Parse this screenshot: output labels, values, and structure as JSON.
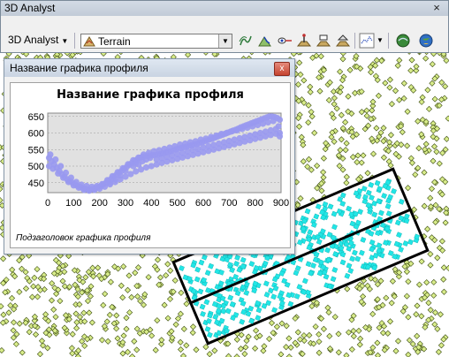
{
  "toolbar": {
    "title": "3D Analyst",
    "close_glyph": "×",
    "menu_label": "3D Analyst",
    "layer_value": "Terrain",
    "tools": [
      "contour-icon",
      "steepest-path-icon",
      "line-of-sight-icon",
      "interpolate-point-icon",
      "interpolate-line-icon",
      "interpolate-polygon-icon",
      "profile-graph-icon",
      "arcscene-icon",
      "arcglobe-icon"
    ]
  },
  "profile_window": {
    "title": "Название графика профиля",
    "close_glyph": "x"
  },
  "chart_data": {
    "type": "scatter",
    "title": "Название графика профиля",
    "subtitle": "Подзаголовок графика профиля",
    "xlabel": "",
    "ylabel": "",
    "xlim": [
      0,
      900
    ],
    "ylim": [
      420,
      660
    ],
    "x_ticks": [
      0,
      100,
      200,
      300,
      400,
      500,
      600,
      700,
      800,
      900
    ],
    "y_ticks": [
      450,
      500,
      550,
      600,
      650
    ],
    "grid": true,
    "series": [
      {
        "color": "#9999f0",
        "points": [
          [
            5,
            525
          ],
          [
            15,
            515
          ],
          [
            25,
            505
          ],
          [
            35,
            495
          ],
          [
            45,
            485
          ],
          [
            55,
            475
          ],
          [
            65,
            468
          ],
          [
            75,
            460
          ],
          [
            85,
            455
          ],
          [
            95,
            450
          ],
          [
            105,
            445
          ],
          [
            115,
            440
          ],
          [
            125,
            437
          ],
          [
            135,
            434
          ],
          [
            145,
            432
          ],
          [
            155,
            430
          ],
          [
            165,
            430
          ],
          [
            175,
            431
          ],
          [
            185,
            433
          ],
          [
            195,
            436
          ],
          [
            205,
            440
          ],
          [
            215,
            445
          ],
          [
            225,
            450
          ],
          [
            235,
            456
          ],
          [
            245,
            462
          ],
          [
            255,
            468
          ],
          [
            265,
            474
          ],
          [
            275,
            480
          ],
          [
            285,
            486
          ],
          [
            295,
            492
          ],
          [
            305,
            498
          ],
          [
            315,
            504
          ],
          [
            325,
            510
          ],
          [
            335,
            516
          ],
          [
            345,
            520
          ],
          [
            355,
            525
          ],
          [
            365,
            528
          ],
          [
            375,
            530
          ],
          [
            385,
            531
          ],
          [
            395,
            532
          ],
          [
            405,
            533
          ],
          [
            415,
            534
          ],
          [
            425,
            535
          ],
          [
            435,
            537
          ],
          [
            445,
            539
          ],
          [
            455,
            541
          ],
          [
            465,
            543
          ],
          [
            475,
            545
          ],
          [
            485,
            548
          ],
          [
            495,
            551
          ],
          [
            505,
            553
          ],
          [
            515,
            555
          ],
          [
            525,
            557
          ],
          [
            535,
            559
          ],
          [
            545,
            561
          ],
          [
            555,
            563
          ],
          [
            565,
            565
          ],
          [
            575,
            567
          ],
          [
            585,
            570
          ],
          [
            595,
            572
          ],
          [
            605,
            575
          ],
          [
            615,
            578
          ],
          [
            625,
            580
          ],
          [
            635,
            583
          ],
          [
            645,
            586
          ],
          [
            655,
            589
          ],
          [
            665,
            592
          ],
          [
            675,
            595
          ],
          [
            685,
            598
          ],
          [
            695,
            601
          ],
          [
            705,
            604
          ],
          [
            715,
            607
          ],
          [
            725,
            610
          ],
          [
            735,
            613
          ],
          [
            745,
            617
          ],
          [
            755,
            620
          ],
          [
            765,
            623
          ],
          [
            775,
            626
          ],
          [
            785,
            629
          ],
          [
            795,
            632
          ],
          [
            805,
            635
          ],
          [
            815,
            638
          ],
          [
            825,
            641
          ],
          [
            835,
            644
          ],
          [
            845,
            647
          ],
          [
            855,
            650
          ],
          [
            865,
            650
          ],
          [
            875,
            648
          ],
          [
            885,
            645
          ],
          [
            895,
            640
          ],
          [
            5,
            500
          ],
          [
            20,
            492
          ],
          [
            40,
            478
          ],
          [
            60,
            465
          ],
          [
            80,
            452
          ],
          [
            100,
            442
          ],
          [
            120,
            435
          ],
          [
            140,
            428
          ],
          [
            160,
            426
          ],
          [
            180,
            428
          ],
          [
            200,
            432
          ],
          [
            220,
            438
          ],
          [
            240,
            445
          ],
          [
            260,
            452
          ],
          [
            280,
            460
          ],
          [
            300,
            468
          ],
          [
            320,
            476
          ],
          [
            340,
            484
          ],
          [
            360,
            490
          ],
          [
            380,
            496
          ],
          [
            400,
            500
          ],
          [
            420,
            505
          ],
          [
            440,
            510
          ],
          [
            460,
            514
          ],
          [
            480,
            518
          ],
          [
            500,
            522
          ],
          [
            520,
            526
          ],
          [
            540,
            530
          ],
          [
            560,
            534
          ],
          [
            580,
            538
          ],
          [
            600,
            542
          ],
          [
            620,
            546
          ],
          [
            640,
            550
          ],
          [
            660,
            554
          ],
          [
            680,
            558
          ],
          [
            700,
            562
          ],
          [
            720,
            566
          ],
          [
            740,
            570
          ],
          [
            760,
            574
          ],
          [
            780,
            578
          ],
          [
            800,
            582
          ],
          [
            820,
            586
          ],
          [
            840,
            590
          ],
          [
            860,
            594
          ],
          [
            880,
            598
          ],
          [
            895,
            600
          ],
          [
            10,
            535
          ],
          [
            30,
            520
          ],
          [
            50,
            500
          ],
          [
            70,
            480
          ],
          [
            90,
            465
          ],
          [
            110,
            452
          ],
          [
            130,
            444
          ],
          [
            150,
            440
          ],
          [
            170,
            438
          ],
          [
            190,
            440
          ],
          [
            210,
            446
          ],
          [
            230,
            458
          ],
          [
            250,
            470
          ],
          [
            270,
            482
          ],
          [
            290,
            494
          ],
          [
            310,
            506
          ],
          [
            330,
            518
          ],
          [
            350,
            526
          ],
          [
            370,
            535
          ],
          [
            390,
            540
          ],
          [
            410,
            545
          ],
          [
            430,
            548
          ],
          [
            450,
            552
          ],
          [
            470,
            556
          ],
          [
            490,
            560
          ],
          [
            510,
            565
          ],
          [
            530,
            568
          ],
          [
            550,
            572
          ],
          [
            570,
            575
          ],
          [
            590,
            580
          ],
          [
            610,
            583
          ],
          [
            630,
            588
          ],
          [
            650,
            592
          ],
          [
            670,
            597
          ],
          [
            690,
            600
          ],
          [
            710,
            605
          ],
          [
            730,
            608
          ],
          [
            750,
            612
          ],
          [
            770,
            616
          ],
          [
            790,
            620
          ],
          [
            810,
            624
          ],
          [
            830,
            628
          ],
          [
            850,
            632
          ],
          [
            870,
            636
          ],
          [
            890,
            620
          ],
          [
            420,
            520
          ],
          [
            440,
            524
          ],
          [
            460,
            528
          ],
          [
            480,
            532
          ],
          [
            500,
            536
          ],
          [
            520,
            540
          ],
          [
            540,
            544
          ],
          [
            560,
            548
          ],
          [
            580,
            552
          ],
          [
            600,
            556
          ],
          [
            620,
            560
          ],
          [
            640,
            564
          ],
          [
            660,
            568
          ],
          [
            680,
            572
          ],
          [
            700,
            576
          ],
          [
            720,
            580
          ],
          [
            740,
            584
          ],
          [
            760,
            588
          ],
          [
            780,
            592
          ],
          [
            800,
            596
          ],
          [
            820,
            600
          ],
          [
            840,
            604
          ],
          [
            860,
            608
          ],
          [
            880,
            612
          ],
          [
            895,
            590
          ],
          [
            330,
            500
          ],
          [
            340,
            510
          ],
          [
            300,
            485
          ],
          [
            280,
            472
          ],
          [
            260,
            460
          ],
          [
            240,
            450
          ],
          [
            350,
            505
          ],
          [
            365,
            515
          ],
          [
            380,
            520
          ],
          [
            395,
            525
          ]
        ]
      }
    ]
  }
}
